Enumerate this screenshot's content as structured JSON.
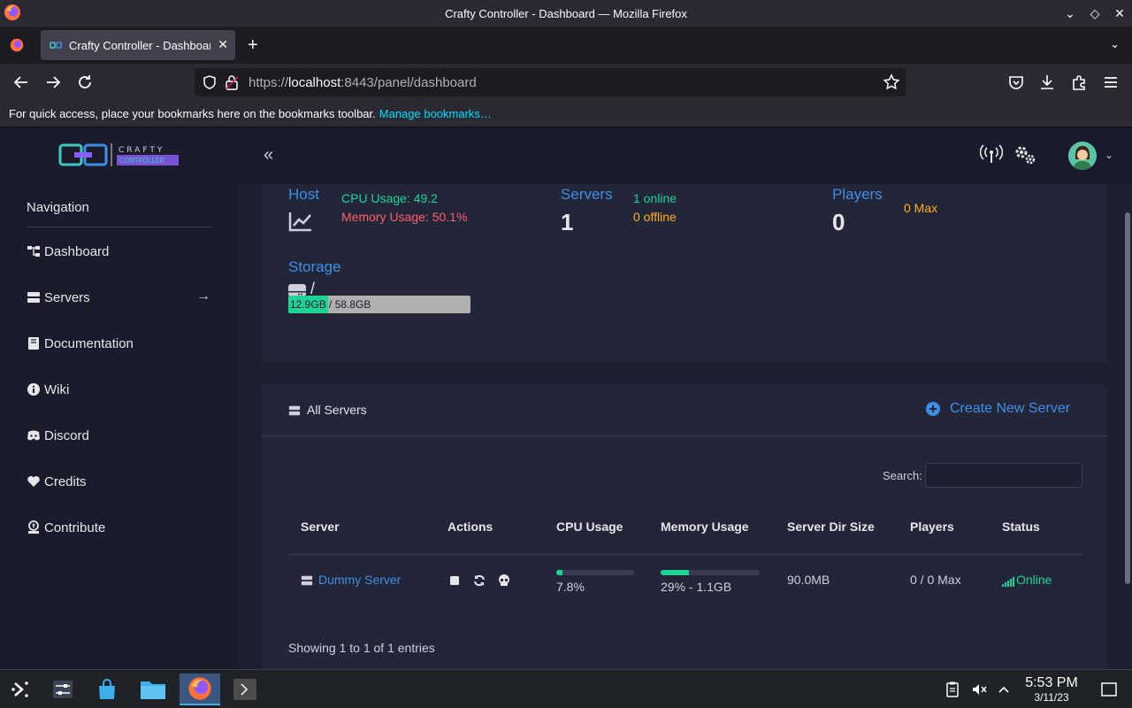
{
  "window": {
    "title": "Crafty Controller - Dashboard — Mozilla Firefox"
  },
  "browser": {
    "tab_label": "Crafty Controller - Dashboard",
    "url_prefix": "https://",
    "url_host": "localhost",
    "url_rest": ":8443/panel/dashboard",
    "bookmarks_hint": "For quick access, place your bookmarks here on the bookmarks toolbar.",
    "bookmarks_link": "Manage bookmarks…"
  },
  "app": {
    "logo_text_top": "CRAFTY",
    "logo_text_bottom": "CONTROLLER"
  },
  "sidebar": {
    "title": "Navigation",
    "items": [
      {
        "label": "Dashboard",
        "icon": "sitemap-icon"
      },
      {
        "label": "Servers",
        "icon": "server-icon"
      },
      {
        "label": "Documentation",
        "icon": "book-icon"
      },
      {
        "label": "Wiki",
        "icon": "info-circle-icon"
      },
      {
        "label": "Discord",
        "icon": "discord-icon"
      },
      {
        "label": "Credits",
        "icon": "heart-icon"
      },
      {
        "label": "Contribute",
        "icon": "donate-icon"
      }
    ]
  },
  "stats": {
    "host_label": "Host",
    "cpu_usage": "CPU Usage: 49.2",
    "memory_usage": "Memory Usage: 50.1%",
    "servers_label": "Servers",
    "servers_count": "1",
    "servers_online": "1 online",
    "servers_offline": "0 offline",
    "players_label": "Players",
    "players_count": "0",
    "players_max": "0 Max",
    "storage_label": "Storage",
    "storage_mount": "/",
    "storage_used": "12.9GB",
    "storage_total": "58.8GB",
    "storage_fraction": 0.219
  },
  "servers_panel": {
    "title": "All Servers",
    "create_label": "Create New Server",
    "search_label": "Search:",
    "columns": [
      "Server",
      "Actions",
      "CPU Usage",
      "Memory Usage",
      "Server Dir Size",
      "Players",
      "Status"
    ],
    "rows": [
      {
        "name": "Dummy Server",
        "cpu": "7.8%",
        "cpu_fraction": 0.078,
        "memory": "29% - 1.1GB",
        "memory_fraction": 0.29,
        "dir_size": "90.0MB",
        "players": "0 / 0 Max",
        "status": "Online"
      }
    ],
    "showing": "Showing 1 to 1 of 1 entries"
  },
  "taskbar": {
    "time": "5:53 PM",
    "date": "3/11/23"
  },
  "colors": {
    "accent": "#3d8fe6",
    "online": "#1fd397",
    "danger": "#ff5e6c",
    "warning": "#ffae18"
  }
}
